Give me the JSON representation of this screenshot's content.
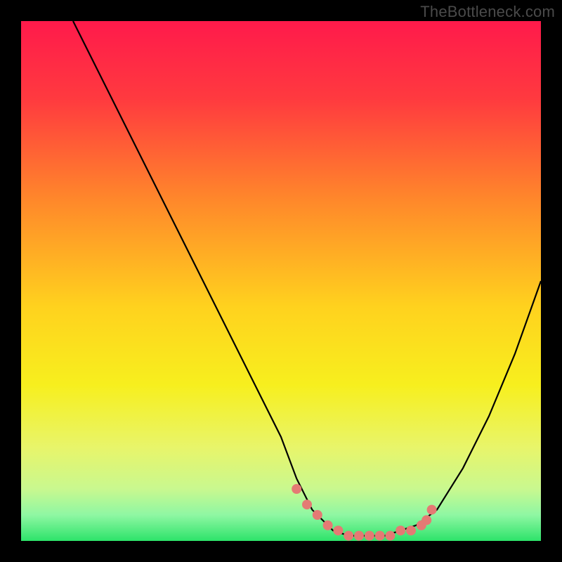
{
  "watermark": "TheBottleneck.com",
  "chart_data": {
    "type": "line",
    "title": "",
    "xlabel": "",
    "ylabel": "",
    "xlim": [
      0,
      100
    ],
    "ylim": [
      0,
      100
    ],
    "series": [
      {
        "name": "curve",
        "x": [
          10,
          15,
          20,
          25,
          30,
          35,
          40,
          45,
          50,
          53,
          56,
          60,
          63,
          66,
          70,
          73,
          76,
          80,
          85,
          90,
          95,
          100
        ],
        "values": [
          100,
          90,
          80,
          70,
          60,
          50,
          40,
          30,
          20,
          12,
          6,
          2,
          1,
          1,
          1,
          2,
          3,
          6,
          14,
          24,
          36,
          50
        ]
      }
    ],
    "highlight_region": {
      "name": "bottom-dots",
      "x": [
        53,
        55,
        57,
        59,
        61,
        63,
        65,
        67,
        69,
        71,
        73,
        75,
        77,
        78,
        79
      ],
      "values": [
        10,
        7,
        5,
        3,
        2,
        1,
        1,
        1,
        1,
        1,
        2,
        2,
        3,
        4,
        6
      ]
    },
    "background_gradient_stops": [
      {
        "offset": 0.0,
        "color": "#ff1a4b"
      },
      {
        "offset": 0.15,
        "color": "#ff3a3f"
      },
      {
        "offset": 0.35,
        "color": "#ff8a2a"
      },
      {
        "offset": 0.55,
        "color": "#ffd21e"
      },
      {
        "offset": 0.7,
        "color": "#f7ef1e"
      },
      {
        "offset": 0.82,
        "color": "#e8f56a"
      },
      {
        "offset": 0.9,
        "color": "#c9f88f"
      },
      {
        "offset": 0.95,
        "color": "#8ff7a3"
      },
      {
        "offset": 1.0,
        "color": "#2de36a"
      }
    ],
    "colors": {
      "curve": "#000000",
      "dots": "#e47a74"
    }
  }
}
